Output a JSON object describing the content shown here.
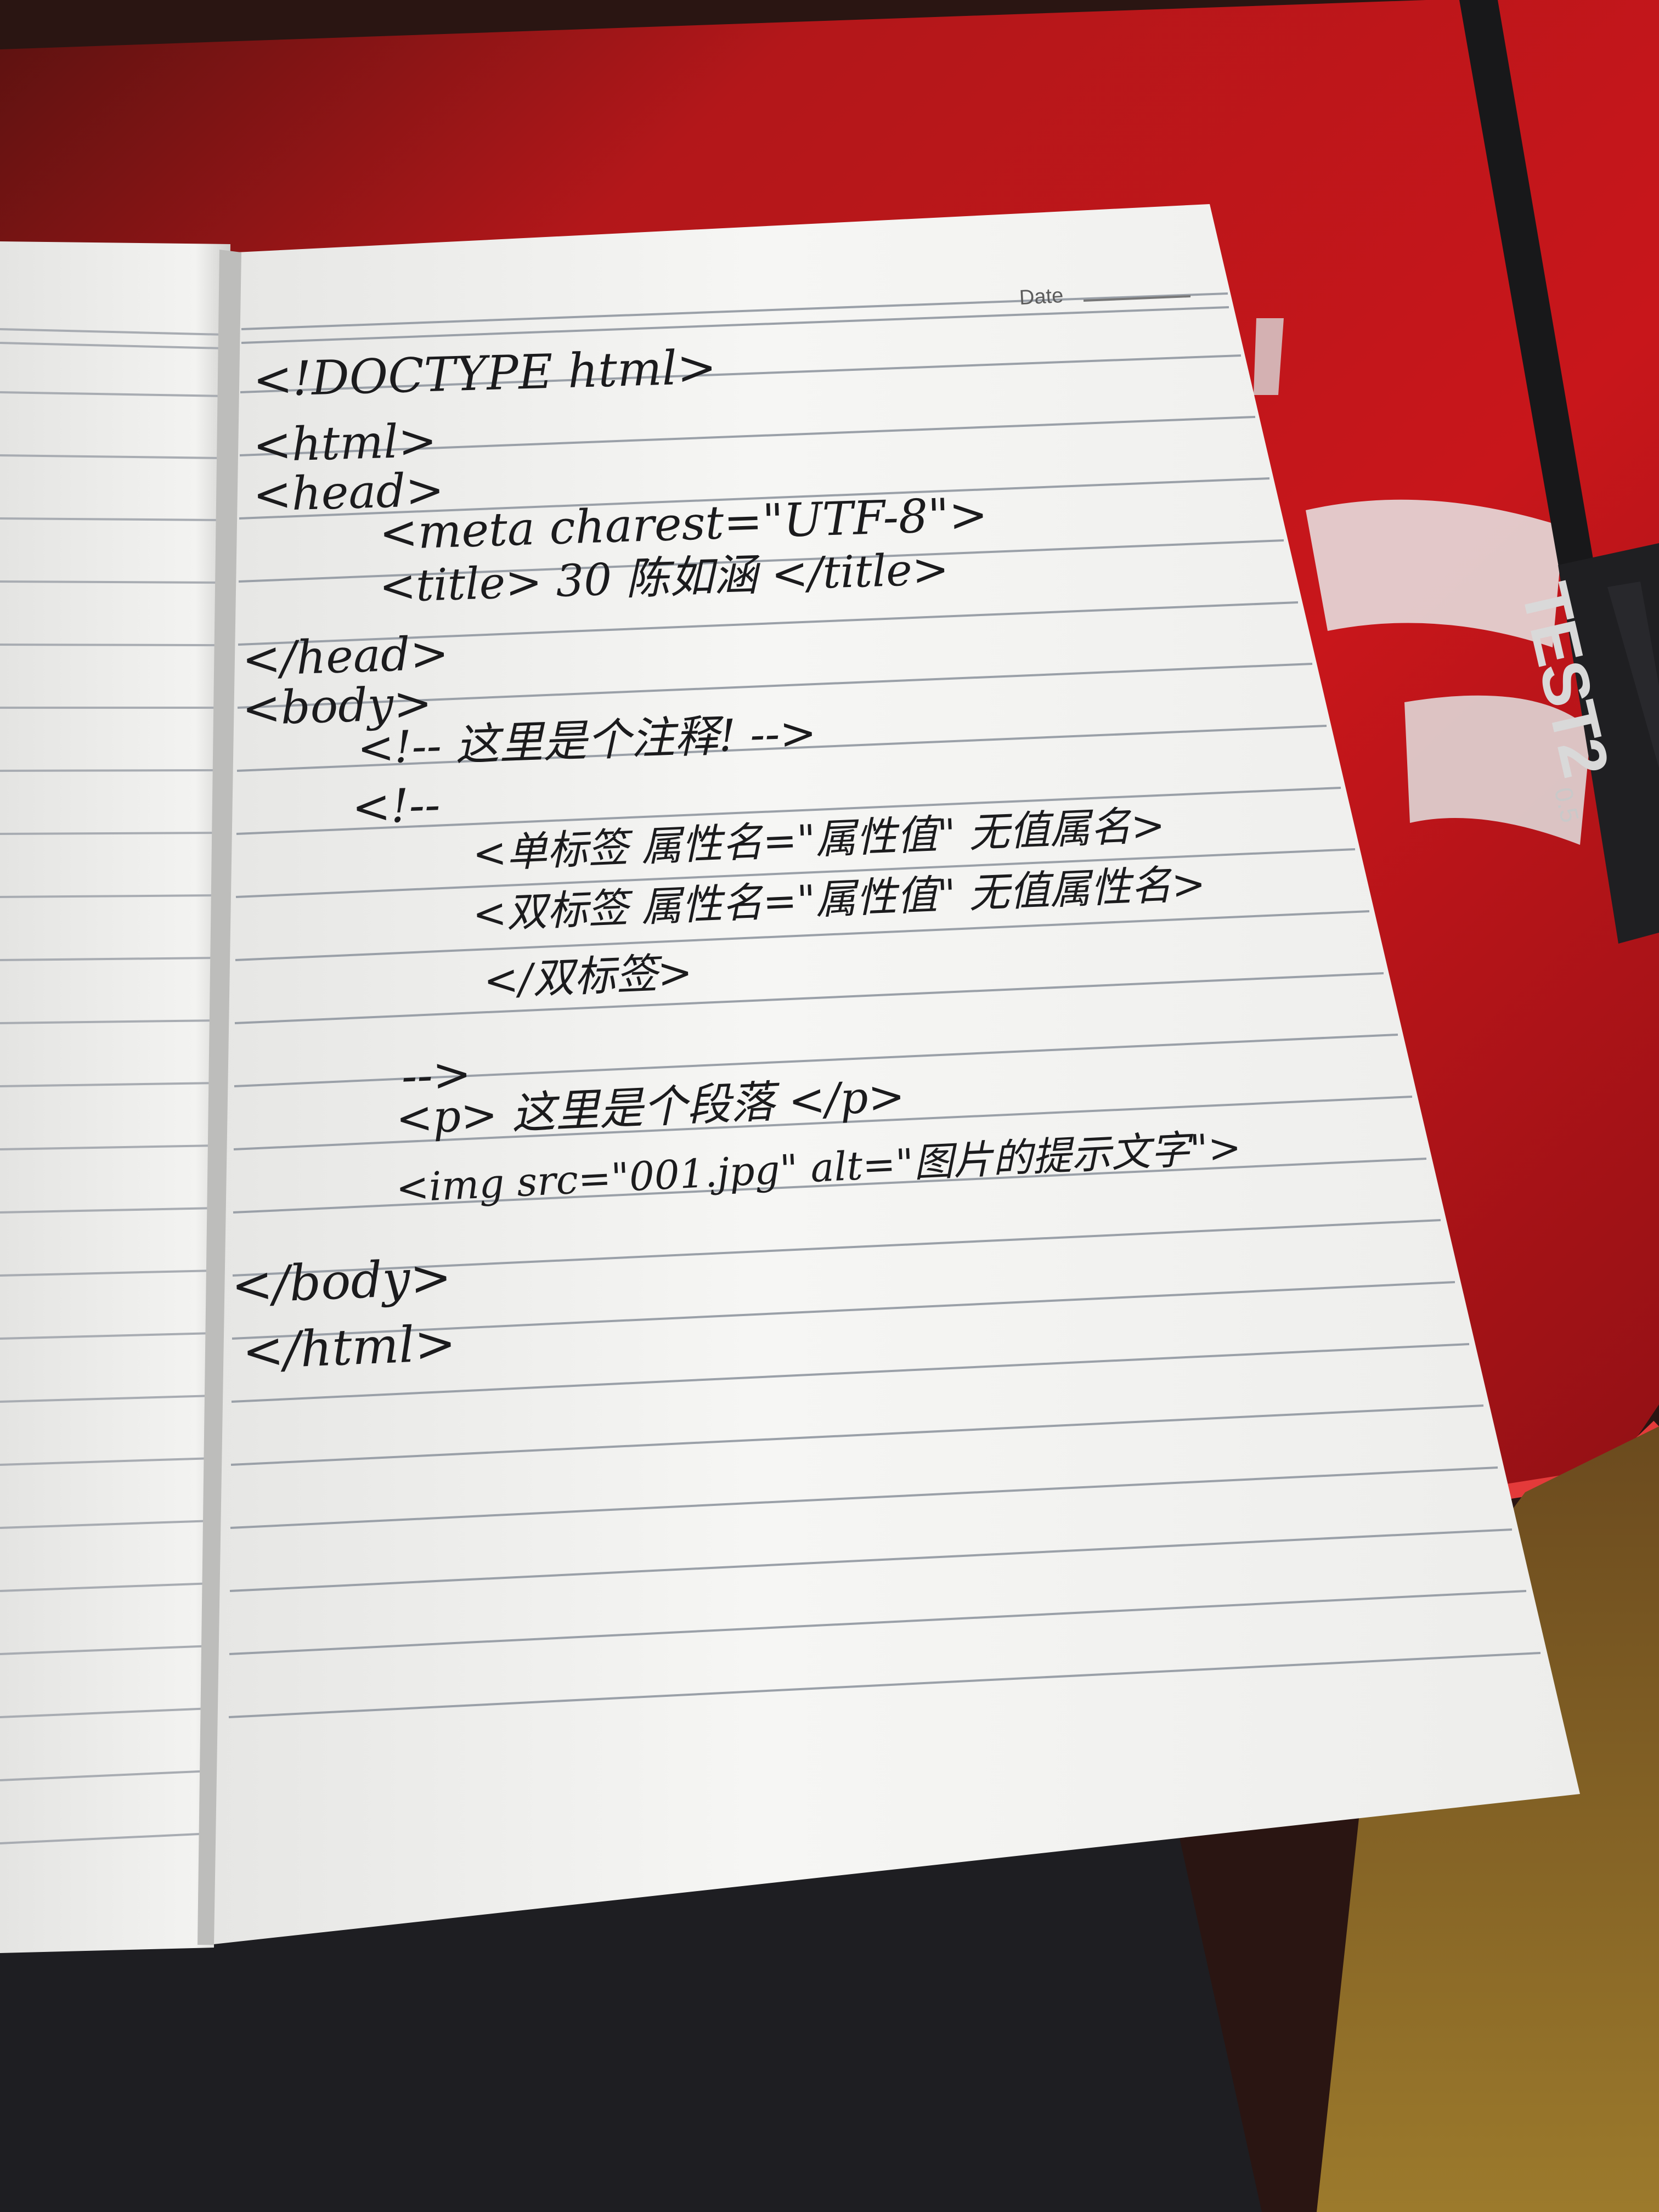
{
  "notebook": {
    "date_label": "Date",
    "lines": [
      "<!DOCTYPE html>",
      "<html>",
      "<head>",
      "<meta charest=\"UTF-8\">",
      "<title> 30 陈如涵 </title>",
      "</head>",
      "<body>",
      "<!-- 这里是个注释! -->",
      "<!--",
      "<单标签 属性名=\"属性值\" 无值属名>",
      "<双标签 属性名=\"属性值\" 无值属性名>",
      "</双标签>",
      "-->",
      "<p> 这里是个段落 </p>",
      "<img src=\"001.jpg\" alt=\"图片的提示文字\">",
      "</body>",
      "</html>"
    ]
  },
  "pen": {
    "brand": "TEST2",
    "size": "0.5"
  },
  "colors": {
    "mousepad_red": "#c8141a",
    "paper": "#f2f2f0",
    "ink": "#1b1b1d",
    "rule_line": "#9aa0a8"
  }
}
